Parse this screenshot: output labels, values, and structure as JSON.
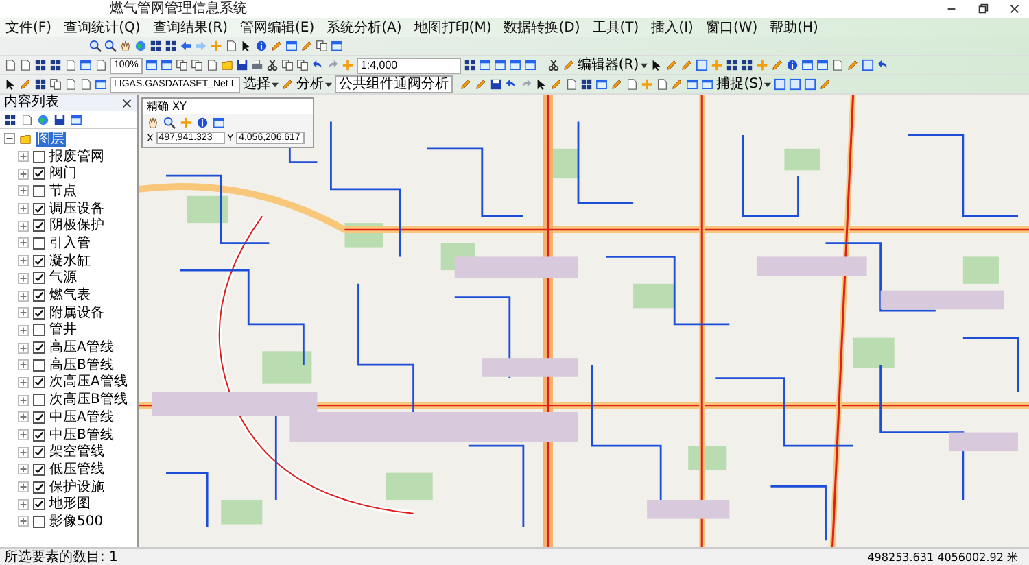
{
  "window": {
    "title": "燃气管网管理信息系统"
  },
  "menu": [
    "文件(F)",
    "查询统计(Q)",
    "查询结果(R)",
    "管网编辑(E)",
    "系统分析(A)",
    "地图打印(M)",
    "数据转换(D)",
    "工具(T)",
    "插入(I)",
    "窗口(W)",
    "帮助(H)"
  ],
  "toolbars": {
    "zoom_level": "100%",
    "scale": "1:4,000",
    "editor_menu": "编辑器(R)",
    "target_layer": "LIGAS.GASDATASET_Net L",
    "select_menu": "选择",
    "analysis_menu": "分析",
    "analysis_tool": "公共组件通阀分析",
    "snap_menu": "捕捉(S)"
  },
  "toc": {
    "title": "内容列表",
    "root": {
      "label": "图层",
      "selected": true,
      "expanded": true,
      "children": [
        {
          "label": "报废管网",
          "checked": false
        },
        {
          "label": "阀门",
          "checked": true
        },
        {
          "label": "节点",
          "checked": false
        },
        {
          "label": "调压设备",
          "checked": true
        },
        {
          "label": "阴极保护",
          "checked": true
        },
        {
          "label": "引入管",
          "checked": false
        },
        {
          "label": "凝水缸",
          "checked": true
        },
        {
          "label": "气源",
          "checked": true
        },
        {
          "label": "燃气表",
          "checked": true
        },
        {
          "label": "附属设备",
          "checked": true
        },
        {
          "label": "管井",
          "checked": false
        },
        {
          "label": "高压A管线",
          "checked": true
        },
        {
          "label": "高压B管线",
          "checked": false
        },
        {
          "label": "次高压A管线",
          "checked": true
        },
        {
          "label": "次高压B管线",
          "checked": false
        },
        {
          "label": "中压A管线",
          "checked": true
        },
        {
          "label": "中压B管线",
          "checked": true
        },
        {
          "label": "架空管线",
          "checked": true
        },
        {
          "label": "低压管线",
          "checked": true
        },
        {
          "label": "保护设施",
          "checked": true
        },
        {
          "label": "地形图",
          "checked": true
        },
        {
          "label": "影像500",
          "checked": false
        }
      ]
    }
  },
  "xy_window": {
    "title": "精确 XY",
    "x_label": "X",
    "x_value": "497,941.323",
    "y_label": "Y",
    "y_value": "4,056,206.617"
  },
  "status_bar": {
    "selection": "所选要素的数目: 1",
    "coordinates": "498253.631  4056002.92 米"
  }
}
